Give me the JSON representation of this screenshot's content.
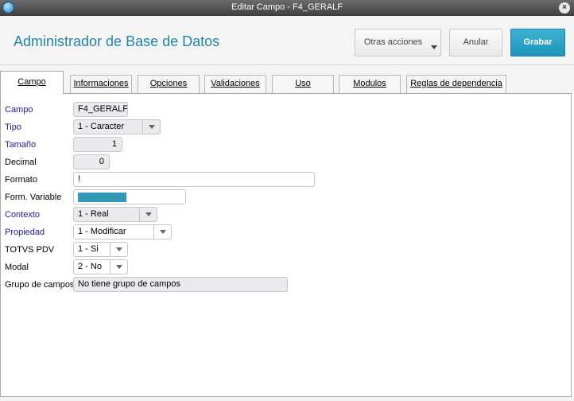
{
  "window": {
    "title": "Editar Campo - F4_GERALF"
  },
  "header": {
    "app_title": "Administrador de Base de Datos",
    "otras_label": "Otras acciones",
    "anular_label": "Anular",
    "grabar_label": "Grabar"
  },
  "tabs": [
    {
      "label": "Campo",
      "active": true
    },
    {
      "label": "Informaciones"
    },
    {
      "label": "Opciones"
    },
    {
      "label": "Validaciones"
    },
    {
      "label": "Uso"
    },
    {
      "label": "Modulos"
    },
    {
      "label": "Reglas de dependencia"
    }
  ],
  "form": {
    "campo": {
      "label": "Campo",
      "value": "F4_GERALF"
    },
    "tipo": {
      "label": "Tipo",
      "value": "1 - Caracter"
    },
    "tamano": {
      "label": "Tamaño",
      "value": "1"
    },
    "decimal": {
      "label": "Decimal",
      "value": "0"
    },
    "formato": {
      "label": "Formato",
      "value": "!"
    },
    "form_variable": {
      "label": "Form. Variable"
    },
    "contexto": {
      "label": "Contexto",
      "value": "1 - Real"
    },
    "propiedad": {
      "label": "Propiedad",
      "value": "1 - Modificar"
    },
    "totvs_pdv": {
      "label": "TOTVS PDV",
      "value": "1 - Si"
    },
    "modal": {
      "label": "Modal",
      "value": "2 - No"
    },
    "grupo": {
      "label": "Grupo de campos",
      "value": "No tiene grupo de campos"
    }
  },
  "colors": {
    "accent": "#2585a9",
    "primary_button": "#1f93b9",
    "required_label": "#1c1c8c"
  }
}
